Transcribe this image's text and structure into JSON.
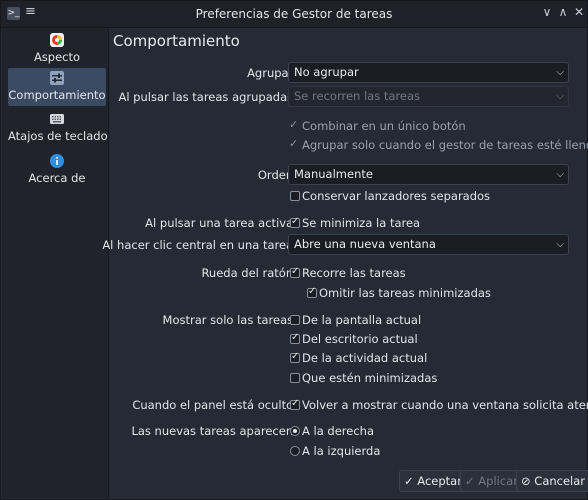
{
  "window": {
    "title": "Preferencias de Gestor de tareas"
  },
  "titlebar": {
    "app_icon": ">_",
    "menu_icon": "≡",
    "minimize_icon": "∨",
    "maximize_icon": "∧",
    "close_icon": "✕"
  },
  "sidebar": {
    "items": [
      {
        "label": "Aspecto"
      },
      {
        "label": "Comportamiento"
      },
      {
        "label": "Atajos de teclado"
      },
      {
        "label": "Acerca de"
      }
    ]
  },
  "main": {
    "heading": "Comportamiento",
    "agrupar": {
      "label": "Agrupar:",
      "value": "No agrupar"
    },
    "pulsar_agrupadas": {
      "label": "Al pulsar las tareas agrupadas:",
      "value": "Se recorren las tareas"
    },
    "combinar": "Combinar en un único botón",
    "agrupar_lleno": "Agrupar solo cuando el gestor de tareas esté lleno",
    "orden": {
      "label": "Orden:",
      "value": "Manualmente"
    },
    "conservar": "Conservar lanzadores separados",
    "pulsar_activa": {
      "label": "Al pulsar una tarea activa:",
      "option": "Se minimiza la tarea"
    },
    "clic_central": {
      "label": "Al hacer clic central en una tarea:",
      "value": "Abre una nueva ventana"
    },
    "rueda": {
      "label": "Rueda del ratón:",
      "option": "Recorre las tareas",
      "sub_option": "Omitir las tareas minimizadas"
    },
    "mostrar_solo": {
      "label": "Mostrar solo las tareas:",
      "options": [
        "De la pantalla actual",
        "Del escritorio actual",
        "De la actividad actual",
        "Que estén minimizadas"
      ]
    },
    "panel_oculto": {
      "label": "Cuando el panel está oculto:",
      "option": "Volver a mostrar cuando una ventana solicita atención"
    },
    "nuevas_tareas": {
      "label": "Las nuevas tareas aparecen:",
      "options": [
        "A la derecha",
        "A la izquierda"
      ]
    }
  },
  "buttons": {
    "accept": "Aceptar",
    "apply": "Aplicar",
    "cancel": "Cancelar",
    "accept_icon": "✓",
    "apply_icon": "✓",
    "cancel_icon": "⊘"
  }
}
